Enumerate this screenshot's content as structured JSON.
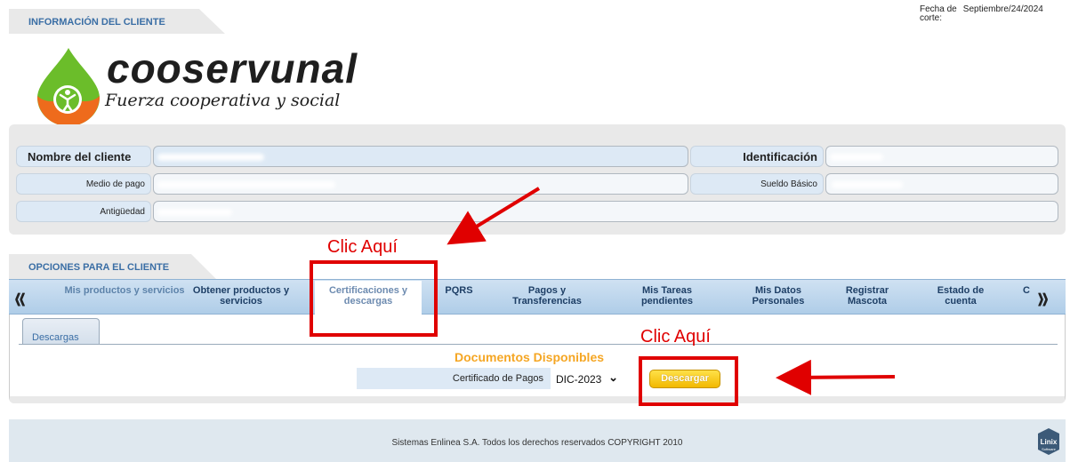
{
  "header": {
    "section_title": "INFORMACIÓN DEL CLIENTE",
    "fecha_label": "Fecha de corte:",
    "fecha_value": "Septiembre/24/2024"
  },
  "brand": {
    "name": "cooservunal",
    "slogan": "Fuerza cooperativa y social",
    "colors": {
      "green": "#6bbd2a",
      "orange": "#ee6b1c"
    }
  },
  "client": {
    "nombre_label": "Nombre del cliente",
    "identificacion_label": "Identificación",
    "medio_pago_label": "Medio de pago",
    "sueldo_label": "Sueldo Básico",
    "antiguedad_label": "Antigüedad"
  },
  "options": {
    "section_title": "OPCIONES PARA EL CLIENTE",
    "nav_items": [
      "Mis productos y servicios",
      "Obtener productos y servicios",
      "Certificaciones y descargas",
      "PQRS",
      "Pagos y Transferencias",
      "Mis Tareas pendientes",
      "Mis Datos Personales",
      "Registrar Mascota",
      "Estado de cuenta",
      "C"
    ],
    "sub_tab": "Descargas",
    "documents_title": "Documentos Disponibles",
    "cert_label": "Certificado de Pagos",
    "cert_value": "DIC-2023",
    "download_button": "Descargar"
  },
  "annotations": {
    "note1": "Clic Aquí",
    "note2": "Clic Aquí",
    "color": "#e00000"
  },
  "footer": {
    "copyright": "Sistemas Enlinea S.A. Todos los derechos reservados COPYRIGHT 2010",
    "linix_logo": "Linix",
    "linix_sub": "Software"
  }
}
